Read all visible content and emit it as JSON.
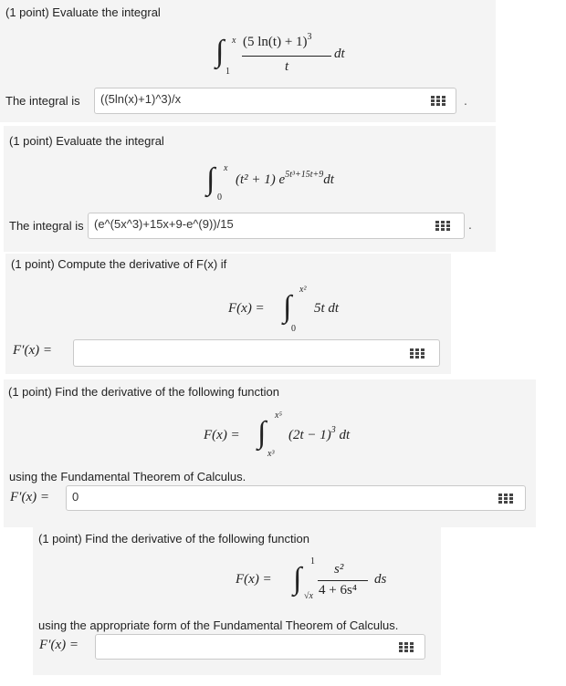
{
  "problems": [
    {
      "header": "(1 point) Evaluate the integral",
      "integral": {
        "upper": "x",
        "lower": "1",
        "numerator": "(5 ln(t) + 1)",
        "num_exp": "3",
        "denominator": "t",
        "dvar": "dt"
      },
      "answer_label": "The integral is",
      "answer_value": "((5ln(x)+1)^3)/x"
    },
    {
      "header": "(1 point) Evaluate the integral",
      "integral": {
        "upper": "x",
        "lower": "0",
        "integrand": "(t² + 1) e",
        "exp": "5t³+15t+9",
        "dvar": "dt"
      },
      "answer_label": "The integral is",
      "answer_value": "(e^(5x^3)+15x+9-e^(9))/15"
    },
    {
      "header": "(1 point) Compute the derivative of F(x) if",
      "formula": {
        "lhs": "F(x) =",
        "upper": "x²",
        "lower": "0",
        "integrand": "5t dt"
      },
      "answer_label": "F′(x) =",
      "answer_value": ""
    },
    {
      "header": "(1 point) Find the derivative of the following function",
      "formula": {
        "lhs": "F(x) =",
        "upper": "x⁵",
        "lower": "x³",
        "integrand": "(2t − 1)",
        "int_exp": "3",
        "dvar": "dt"
      },
      "footer": "using the Fundamental Theorem of Calculus.",
      "answer_label": "F′(x) =",
      "answer_value": "0"
    },
    {
      "header": "(1 point) Find the derivative of the following function",
      "formula": {
        "lhs": "F(x) =",
        "upper": "1",
        "lower": "√x",
        "numerator": "s²",
        "denominator": "4 + 6s⁴",
        "dvar": "ds"
      },
      "footer": "using the appropriate form of the Fundamental Theorem of Calculus.",
      "answer_label": "F′(x) =",
      "answer_value": ""
    }
  ],
  "trailing_dot": "."
}
